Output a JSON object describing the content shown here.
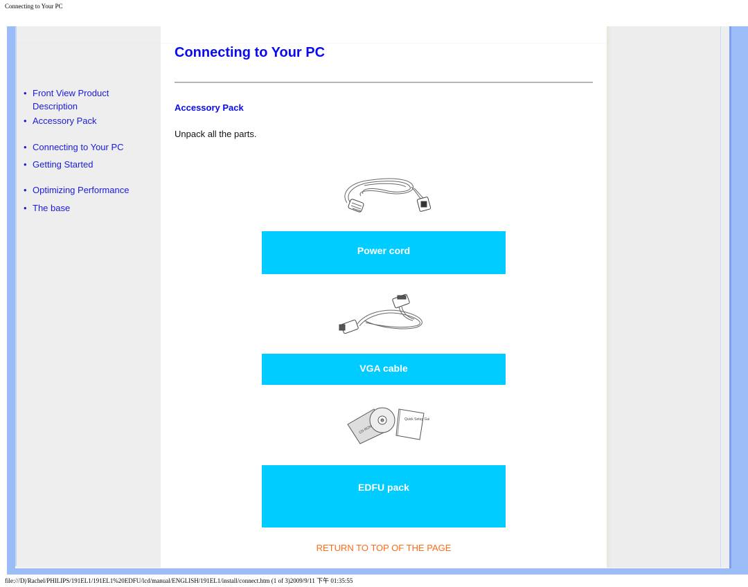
{
  "page_header": "Connecting to Your PC",
  "sidebar": {
    "items": [
      {
        "label": "Front View Product Description"
      },
      {
        "label": "Accessory Pack"
      },
      {
        "label": "Connecting to Your PC"
      },
      {
        "label": "Getting Started"
      },
      {
        "label": "Optimizing Performance"
      },
      {
        "label": "The base"
      }
    ],
    "bullet": "•"
  },
  "main": {
    "title": "Connecting to Your PC",
    "subtitle": "Accessory Pack",
    "intro": "Unpack all the parts.",
    "accessories": [
      {
        "label": "Power cord",
        "icon": "power-cord-icon"
      },
      {
        "label": "VGA cable",
        "icon": "vga-cable-icon"
      },
      {
        "label": "EDFU pack",
        "icon": "edfu-pack-icon"
      }
    ],
    "edfu_text": {
      "cd": "CD-ROM",
      "guide": "Quick Setup Guide"
    },
    "return_link": "RETURN TO TOP OF THE PAGE"
  },
  "colors": {
    "link": "#1a1adb",
    "heading": "#0a0af0",
    "label_box": "#00ccff",
    "return_link": "#ff6a13",
    "frame_border": "#9bbcf7"
  },
  "page_footer": "file:///D|/Rachel/PHILIPS/191EL1/191EL1%20EDFU/lcd/manual/ENGLISH/191EL1/install/connect.htm (1 of 3)2009/9/11 下午 01:35:55"
}
